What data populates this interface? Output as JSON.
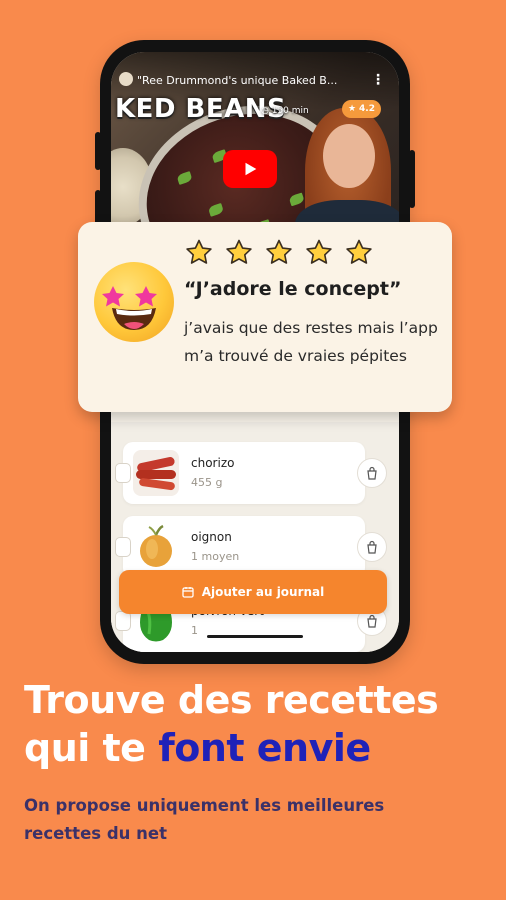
{
  "video": {
    "title": "\"Ree Drummond's unique Baked B...",
    "overlay_title": "KED BEANS",
    "duration": "150 min",
    "rating": "4.2",
    "menu": "⋮"
  },
  "review": {
    "stars": 5,
    "title": "“J’adore le concept”",
    "body": "j’avais que des restes mais l’app m’a trouvé de vraies pépites"
  },
  "ingredients": [
    {
      "name": "chorizo",
      "qty": "455 g"
    },
    {
      "name": "oignon",
      "qty": "1 moyen"
    },
    {
      "name": "poivron vert",
      "qty": "1"
    }
  ],
  "actions": {
    "add_journal": "Ajouter au journal"
  },
  "headline": {
    "line1": "Trouve des recettes",
    "line2_prefix": "qui te ",
    "line2_accent": "font envie"
  },
  "subhead": "On propose uniquement les meilleures recettes du net",
  "colors": {
    "background": "#F98A4C",
    "accent_text": "#1F22B8",
    "button": "#F5852D",
    "play": "#FF0000"
  }
}
